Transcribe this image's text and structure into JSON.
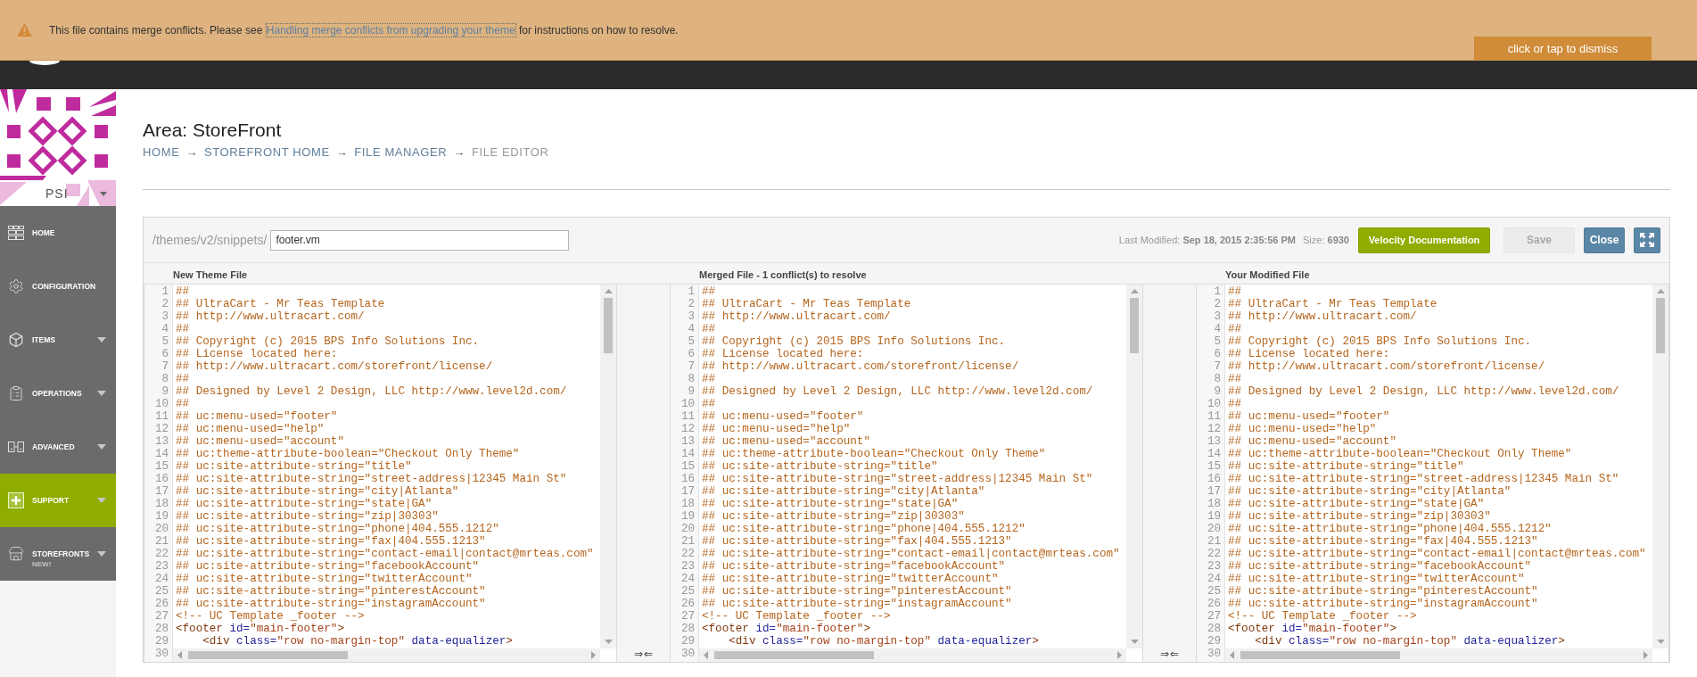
{
  "banner": {
    "message_before": "This file contains merge conflicts. Please see",
    "link": "Handling merge conflicts from upgrading your theme",
    "message_after": "for instructions on how to resolve.",
    "dismiss": "click or tap to dismiss"
  },
  "sidebar": {
    "store": "PSI",
    "items": [
      {
        "label": "HOME",
        "has_submenu": false,
        "selected": false
      },
      {
        "label": "CONFIGURATION",
        "has_submenu": false,
        "selected": false
      },
      {
        "label": "ITEMS",
        "has_submenu": true,
        "selected": false
      },
      {
        "label": "OPERATIONS",
        "has_submenu": true,
        "selected": false
      },
      {
        "label": "ADVANCED",
        "has_submenu": true,
        "selected": false
      },
      {
        "label": "SUPPORT",
        "has_submenu": true,
        "selected": true
      },
      {
        "label": "STOREFRONTS",
        "badge": "NEW!",
        "has_submenu": true,
        "selected": false
      }
    ]
  },
  "page": {
    "title": "Area: StoreFront",
    "breadcrumbs": [
      {
        "kind": "link",
        "label": "HOME"
      },
      {
        "kind": "separator",
        "label": "→"
      },
      {
        "kind": "link",
        "label": "STOREFRONT HOME"
      },
      {
        "kind": "separator",
        "label": "→"
      },
      {
        "kind": "link",
        "label": "FILE MANAGER"
      },
      {
        "kind": "separator",
        "label": "→"
      },
      {
        "kind": "current",
        "label": "FILE EDITOR"
      }
    ]
  },
  "editor": {
    "path": "/themes/v2/snippets/",
    "filename": "footer.vm",
    "last_modified": {
      "label": "Last Modified:",
      "value": "Sep 18, 2015 2:35:56 PM"
    },
    "size": {
      "label": "Size:",
      "value": "6930"
    },
    "buttons": [
      {
        "kind": "docs",
        "label": "Velocity Documentation",
        "disabled": false
      },
      {
        "kind": "save",
        "label": "Save",
        "disabled": true
      },
      {
        "kind": "close",
        "label": "Close",
        "disabled": false
      }
    ],
    "panes": [
      {
        "title": "New Theme File",
        "lines": [
          {
            "number": "1",
            "kind": "comment",
            "code": "##"
          },
          {
            "number": "2",
            "kind": "comment",
            "code": "## UltraCart - Mr Teas Template"
          },
          {
            "number": "3",
            "kind": "comment",
            "code": "## http://www.ultracart.com/"
          },
          {
            "number": "4",
            "kind": "comment",
            "code": "##"
          },
          {
            "number": "5",
            "kind": "comment",
            "code": "## Copyright (c) 2015 BPS Info Solutions Inc."
          },
          {
            "number": "6",
            "kind": "comment",
            "code": "## License located here:"
          },
          {
            "number": "7",
            "kind": "comment",
            "code": "## http://www.ultracart.com/storefront/license/"
          },
          {
            "number": "8",
            "kind": "comment",
            "code": "##"
          },
          {
            "number": "9",
            "kind": "comment",
            "code": "## Designed by Level 2 Design, LLC http://www.level2d.com/"
          },
          {
            "number": "10",
            "kind": "comment",
            "code": "##"
          },
          {
            "number": "11",
            "kind": "comment",
            "code": "## uc:menu-used=\"footer\""
          },
          {
            "number": "12",
            "kind": "comment",
            "code": "## uc:menu-used=\"help\""
          },
          {
            "number": "13",
            "kind": "comment",
            "code": "## uc:menu-used=\"account\""
          },
          {
            "number": "14",
            "kind": "comment",
            "code": "## uc:theme-attribute-boolean=\"Checkout Only Theme\""
          },
          {
            "number": "15",
            "kind": "comment",
            "code": "## uc:site-attribute-string=\"title\""
          },
          {
            "number": "16",
            "kind": "comment",
            "code": "## uc:site-attribute-string=\"street-address|12345 Main St\""
          },
          {
            "number": "17",
            "kind": "comment",
            "code": "## uc:site-attribute-string=\"city|Atlanta\""
          },
          {
            "number": "18",
            "kind": "comment",
            "code": "## uc:site-attribute-string=\"state|GA\""
          },
          {
            "number": "19",
            "kind": "comment",
            "code": "## uc:site-attribute-string=\"zip|30303\""
          },
          {
            "number": "20",
            "kind": "comment",
            "code": "## uc:site-attribute-string=\"phone|404.555.1212\""
          },
          {
            "number": "21",
            "kind": "comment",
            "code": "## uc:site-attribute-string=\"fax|404.555.1213\""
          },
          {
            "number": "22",
            "kind": "comment",
            "code": "## uc:site-attribute-string=\"contact-email|contact@mrteas.com\""
          },
          {
            "number": "23",
            "kind": "comment",
            "code": "## uc:site-attribute-string=\"facebookAccount\""
          },
          {
            "number": "24",
            "kind": "comment",
            "code": "## uc:site-attribute-string=\"twitterAccount\""
          },
          {
            "number": "25",
            "kind": "comment",
            "code": "## uc:site-attribute-string=\"pinterestAccount\""
          },
          {
            "number": "26",
            "kind": "comment",
            "code": "## uc:site-attribute-string=\"instagramAccount\""
          },
          {
            "number": "27",
            "kind": "comment",
            "code": "<!-- UC Template _footer -->"
          },
          {
            "number": "28",
            "tokens": [
              {
                "kind": "tag",
                "text": "<footer"
              },
              {
                "kind": "attribute",
                "text": " id="
              },
              {
                "kind": "string",
                "text": "\"main-footer\""
              },
              {
                "kind": "tag",
                "text": ">"
              }
            ]
          },
          {
            "number": "29",
            "tokens": [
              {
                "kind": "tag",
                "text": "    <div"
              },
              {
                "kind": "attribute",
                "text": " class="
              },
              {
                "kind": "string",
                "text": "\"row no-margin-top\""
              },
              {
                "kind": "attribute",
                "text": " data-equalizer"
              },
              {
                "kind": "tag",
                "text": ">"
              }
            ]
          },
          {
            "number": "30"
          }
        ]
      },
      {
        "title": "Merged File - 1 conflict(s) to resolve",
        "merge_buttons": [
          "⇒",
          "⇐"
        ],
        "lines": [
          {
            "number": "1",
            "kind": "comment",
            "code": "##"
          },
          {
            "number": "2",
            "kind": "comment",
            "code": "## UltraCart - Mr Teas Template"
          },
          {
            "number": "3",
            "kind": "comment",
            "code": "## http://www.ultracart.com/"
          },
          {
            "number": "4",
            "kind": "comment",
            "code": "##"
          },
          {
            "number": "5",
            "kind": "comment",
            "code": "## Copyright (c) 2015 BPS Info Solutions Inc."
          },
          {
            "number": "6",
            "kind": "comment",
            "code": "## License located here:"
          },
          {
            "number": "7",
            "kind": "comment",
            "code": "## http://www.ultracart.com/storefront/license/"
          },
          {
            "number": "8",
            "kind": "comment",
            "code": "##"
          },
          {
            "number": "9",
            "kind": "comment",
            "code": "## Designed by Level 2 Design, LLC http://www.level2d.com/"
          },
          {
            "number": "10",
            "kind": "comment",
            "code": "##"
          },
          {
            "number": "11",
            "kind": "comment",
            "code": "## uc:menu-used=\"footer\""
          },
          {
            "number": "12",
            "kind": "comment",
            "code": "## uc:menu-used=\"help\""
          },
          {
            "number": "13",
            "kind": "comment",
            "code": "## uc:menu-used=\"account\""
          },
          {
            "number": "14",
            "kind": "comment",
            "code": "## uc:theme-attribute-boolean=\"Checkout Only Theme\""
          },
          {
            "number": "15",
            "kind": "comment",
            "code": "## uc:site-attribute-string=\"title\""
          },
          {
            "number": "16",
            "kind": "comment",
            "code": "## uc:site-attribute-string=\"street-address|12345 Main St\""
          },
          {
            "number": "17",
            "kind": "comment",
            "code": "## uc:site-attribute-string=\"city|Atlanta\""
          },
          {
            "number": "18",
            "kind": "comment",
            "code": "## uc:site-attribute-string=\"state|GA\""
          },
          {
            "number": "19",
            "kind": "comment",
            "code": "## uc:site-attribute-string=\"zip|30303\""
          },
          {
            "number": "20",
            "kind": "comment",
            "code": "## uc:site-attribute-string=\"phone|404.555.1212\""
          },
          {
            "number": "21",
            "kind": "comment",
            "code": "## uc:site-attribute-string=\"fax|404.555.1213\""
          },
          {
            "number": "22",
            "kind": "comment",
            "code": "## uc:site-attribute-string=\"contact-email|contact@mrteas.com\""
          },
          {
            "number": "23",
            "kind": "comment",
            "code": "## uc:site-attribute-string=\"facebookAccount\""
          },
          {
            "number": "24",
            "kind": "comment",
            "code": "## uc:site-attribute-string=\"twitterAccount\""
          },
          {
            "number": "25",
            "kind": "comment",
            "code": "## uc:site-attribute-string=\"pinterestAccount\""
          },
          {
            "number": "26",
            "kind": "comment",
            "code": "## uc:site-attribute-string=\"instagramAccount\""
          },
          {
            "number": "27",
            "kind": "comment",
            "code": "<!-- UC Template _footer -->"
          },
          {
            "number": "28",
            "tokens": [
              {
                "kind": "tag",
                "text": "<footer"
              },
              {
                "kind": "attribute",
                "text": " id="
              },
              {
                "kind": "string",
                "text": "\"main-footer\""
              },
              {
                "kind": "tag",
                "text": ">"
              }
            ]
          },
          {
            "number": "29",
            "tokens": [
              {
                "kind": "tag",
                "text": "    <div"
              },
              {
                "kind": "attribute",
                "text": " class="
              },
              {
                "kind": "string",
                "text": "\"row no-margin-top\""
              },
              {
                "kind": "attribute",
                "text": " data-equalizer"
              },
              {
                "kind": "tag",
                "text": ">"
              }
            ]
          },
          {
            "number": "30"
          }
        ]
      },
      {
        "title": "Your Modified File",
        "merge_buttons": [
          "⇒",
          "⇐"
        ],
        "lines": [
          {
            "number": "1",
            "kind": "comment",
            "code": "##"
          },
          {
            "number": "2",
            "kind": "comment",
            "code": "## UltraCart - Mr Teas Template"
          },
          {
            "number": "3",
            "kind": "comment",
            "code": "## http://www.ultracart.com/"
          },
          {
            "number": "4",
            "kind": "comment",
            "code": "##"
          },
          {
            "number": "5",
            "kind": "comment",
            "code": "## Copyright (c) 2015 BPS Info Solutions Inc."
          },
          {
            "number": "6",
            "kind": "comment",
            "code": "## License located here:"
          },
          {
            "number": "7",
            "kind": "comment",
            "code": "## http://www.ultracart.com/storefront/license/"
          },
          {
            "number": "8",
            "kind": "comment",
            "code": "##"
          },
          {
            "number": "9",
            "kind": "comment",
            "code": "## Designed by Level 2 Design, LLC http://www.level2d.com/"
          },
          {
            "number": "10",
            "kind": "comment",
            "code": "##"
          },
          {
            "number": "11",
            "kind": "comment",
            "code": "## uc:menu-used=\"footer\""
          },
          {
            "number": "12",
            "kind": "comment",
            "code": "## uc:menu-used=\"help\""
          },
          {
            "number": "13",
            "kind": "comment",
            "code": "## uc:menu-used=\"account\""
          },
          {
            "number": "14",
            "kind": "comment",
            "code": "## uc:theme-attribute-boolean=\"Checkout Only Theme\""
          },
          {
            "number": "15",
            "kind": "comment",
            "code": "## uc:site-attribute-string=\"title\""
          },
          {
            "number": "16",
            "kind": "comment",
            "code": "## uc:site-attribute-string=\"street-address|12345 Main St\""
          },
          {
            "number": "17",
            "kind": "comment",
            "code": "## uc:site-attribute-string=\"city|Atlanta\""
          },
          {
            "number": "18",
            "kind": "comment",
            "code": "## uc:site-attribute-string=\"state|GA\""
          },
          {
            "number": "19",
            "kind": "comment",
            "code": "## uc:site-attribute-string=\"zip|30303\""
          },
          {
            "number": "20",
            "kind": "comment",
            "code": "## uc:site-attribute-string=\"phone|404.555.1212\""
          },
          {
            "number": "21",
            "kind": "comment",
            "code": "## uc:site-attribute-string=\"fax|404.555.1213\""
          },
          {
            "number": "22",
            "kind": "comment",
            "code": "## uc:site-attribute-string=\"contact-email|contact@mrteas.com\""
          },
          {
            "number": "23",
            "kind": "comment",
            "code": "## uc:site-attribute-string=\"facebookAccount\""
          },
          {
            "number": "24",
            "kind": "comment",
            "code": "## uc:site-attribute-string=\"twitterAccount\""
          },
          {
            "number": "25",
            "kind": "comment",
            "code": "## uc:site-attribute-string=\"pinterestAccount\""
          },
          {
            "number": "26",
            "kind": "comment",
            "code": "## uc:site-attribute-string=\"instagramAccount\""
          },
          {
            "number": "27",
            "kind": "comment",
            "code": "<!-- UC Template _footer -->"
          },
          {
            "number": "28",
            "tokens": [
              {
                "kind": "tag",
                "text": "<footer"
              },
              {
                "kind": "attribute",
                "text": " id="
              },
              {
                "kind": "string",
                "text": "\"main-footer\""
              },
              {
                "kind": "tag",
                "text": ">"
              }
            ]
          },
          {
            "number": "29",
            "tokens": [
              {
                "kind": "tag",
                "text": "    <div"
              },
              {
                "kind": "attribute",
                "text": " class="
              },
              {
                "kind": "string",
                "text": "\"row no-margin-top\""
              },
              {
                "kind": "attribute",
                "text": " data-equalizer"
              },
              {
                "kind": "tag",
                "text": ">"
              }
            ]
          },
          {
            "number": "30"
          }
        ]
      }
    ]
  }
}
